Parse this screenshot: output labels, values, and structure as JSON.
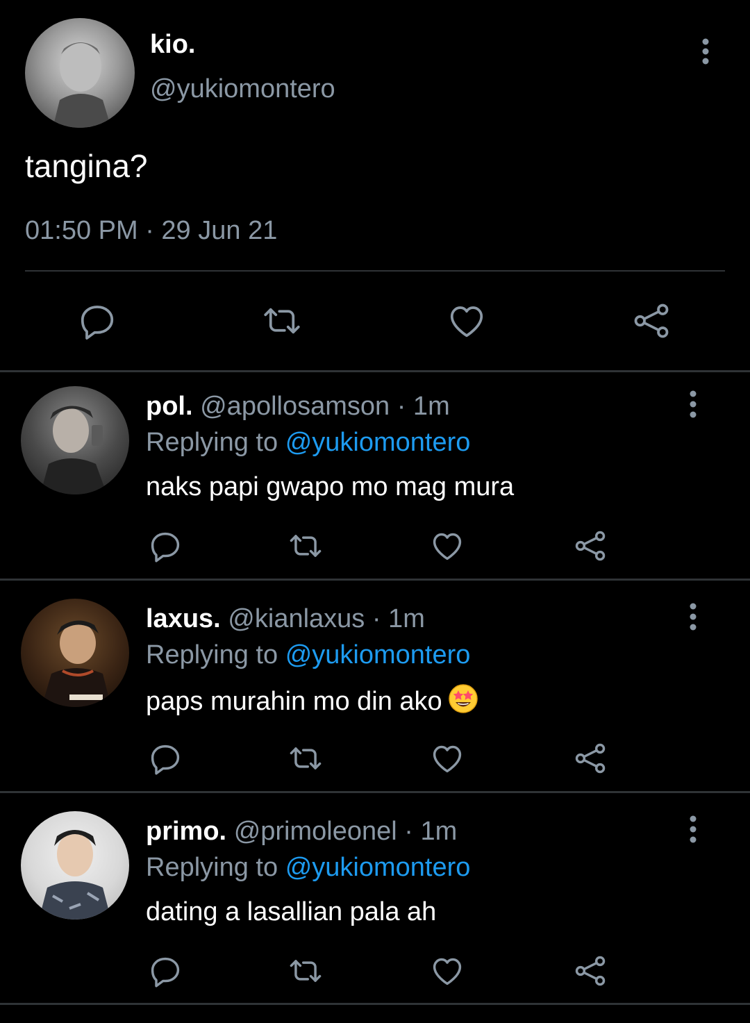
{
  "tweet": {
    "author_name": "kio.",
    "author_handle": "@yukiomontero",
    "text": "tangina?",
    "timestamp": "01:50 PM · 29 Jun 21",
    "actions": [
      "reply-icon",
      "retweet-icon",
      "like-icon",
      "share-icon"
    ]
  },
  "replies": [
    {
      "name": "pol.",
      "meta": "@apollosamson · 1m",
      "replying_label": "Replying to",
      "replying_to": "@yukiomontero",
      "text": "naks papi gwapo mo mag mura",
      "emoji": ""
    },
    {
      "name": "laxus.",
      "meta": "@kianlaxus · 1m",
      "replying_label": "Replying to",
      "replying_to": "@yukiomontero",
      "text": "paps murahin mo din ako",
      "emoji": "star-struck-emoji"
    },
    {
      "name": "primo.",
      "meta": "@primoleonel · 1m",
      "replying_label": "Replying to",
      "replying_to": "@yukiomontero",
      "text": "dating a lasallian pala ah",
      "emoji": ""
    }
  ],
  "colors": {
    "background": "#000000",
    "text": "#ffffff",
    "muted": "#8b98a5",
    "link": "#1d9bf0",
    "divider": "#2f3336"
  }
}
